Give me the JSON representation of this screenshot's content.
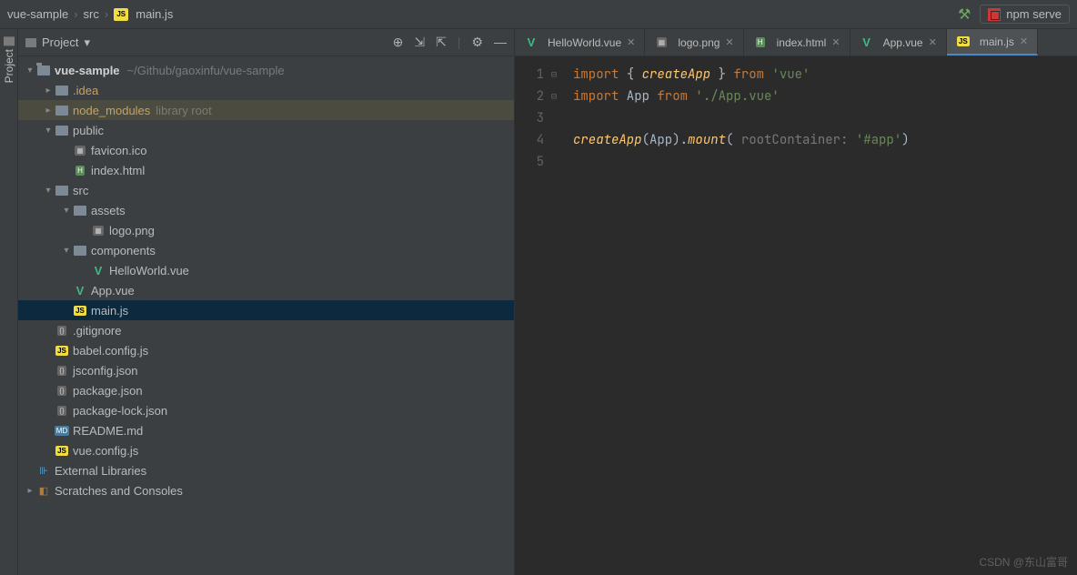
{
  "breadcrumb": {
    "items": [
      "vue-sample",
      "src",
      "main.js"
    ],
    "file_icon": "js"
  },
  "top_right": {
    "build_icon": "hammer",
    "run_config": {
      "icon": "npm",
      "label": "npm serve"
    }
  },
  "left_gutter": {
    "label": "Project"
  },
  "panel": {
    "title": "Project",
    "toolbar_icons": [
      "target",
      "expand",
      "collapse",
      "divider",
      "gear",
      "minimize"
    ]
  },
  "tree": [
    {
      "depth": 0,
      "chevron": "down",
      "icon": "folder-root",
      "label": "vue-sample",
      "bold": true,
      "hint": "~/Github/gaoxinfu/vue-sample"
    },
    {
      "depth": 1,
      "chevron": "right",
      "icon": "folder",
      "label": ".idea",
      "accent": true
    },
    {
      "depth": 1,
      "chevron": "right",
      "icon": "folder",
      "label": "node_modules",
      "accent": true,
      "suffix": "library root",
      "highlighted": true
    },
    {
      "depth": 1,
      "chevron": "down",
      "icon": "folder",
      "label": "public"
    },
    {
      "depth": 2,
      "chevron": "",
      "icon": "img",
      "label": "favicon.ico"
    },
    {
      "depth": 2,
      "chevron": "",
      "icon": "html",
      "label": "index.html"
    },
    {
      "depth": 1,
      "chevron": "down",
      "icon": "folder",
      "label": "src"
    },
    {
      "depth": 2,
      "chevron": "down",
      "icon": "folder",
      "label": "assets"
    },
    {
      "depth": 3,
      "chevron": "",
      "icon": "img",
      "label": "logo.png"
    },
    {
      "depth": 2,
      "chevron": "down",
      "icon": "folder",
      "label": "components"
    },
    {
      "depth": 3,
      "chevron": "",
      "icon": "vue",
      "label": "HelloWorld.vue"
    },
    {
      "depth": 2,
      "chevron": "",
      "icon": "vue",
      "label": "App.vue"
    },
    {
      "depth": 2,
      "chevron": "",
      "icon": "js",
      "label": "main.js",
      "selected": true
    },
    {
      "depth": 1,
      "chevron": "",
      "icon": "json",
      "label": ".gitignore"
    },
    {
      "depth": 1,
      "chevron": "",
      "icon": "js",
      "label": "babel.config.js"
    },
    {
      "depth": 1,
      "chevron": "",
      "icon": "json",
      "label": "jsconfig.json"
    },
    {
      "depth": 1,
      "chevron": "",
      "icon": "json",
      "label": "package.json"
    },
    {
      "depth": 1,
      "chevron": "",
      "icon": "json",
      "label": "package-lock.json"
    },
    {
      "depth": 1,
      "chevron": "",
      "icon": "md",
      "label": "README.md"
    },
    {
      "depth": 1,
      "chevron": "",
      "icon": "js",
      "label": "vue.config.js"
    },
    {
      "depth": 0,
      "chevron": "",
      "icon": "lib",
      "label": "External Libraries"
    },
    {
      "depth": 0,
      "chevron": "right",
      "icon": "scratch",
      "label": "Scratches and Consoles"
    }
  ],
  "tabs": [
    {
      "icon": "vue",
      "label": "HelloWorld.vue",
      "active": false
    },
    {
      "icon": "img",
      "label": "logo.png",
      "active": false
    },
    {
      "icon": "html",
      "label": "index.html",
      "active": false
    },
    {
      "icon": "vue",
      "label": "App.vue",
      "active": false
    },
    {
      "icon": "js",
      "label": "main.js",
      "active": true
    }
  ],
  "editor": {
    "line_numbers": [
      "1",
      "2",
      "3",
      "4",
      "5"
    ],
    "lines": [
      {
        "tokens": [
          {
            "t": "kw",
            "v": "import"
          },
          {
            "t": "ident",
            "v": " { "
          },
          {
            "t": "fn",
            "v": "createApp"
          },
          {
            "t": "ident",
            "v": " } "
          },
          {
            "t": "kw",
            "v": "from"
          },
          {
            "t": "ident",
            "v": " "
          },
          {
            "t": "str",
            "v": "'vue'"
          }
        ]
      },
      {
        "tokens": [
          {
            "t": "kw",
            "v": "import"
          },
          {
            "t": "ident",
            "v": " App "
          },
          {
            "t": "kw",
            "v": "from"
          },
          {
            "t": "ident",
            "v": " "
          },
          {
            "t": "str",
            "v": "'./App.vue'"
          }
        ]
      },
      {
        "tokens": []
      },
      {
        "tokens": [
          {
            "t": "fn",
            "v": "createApp"
          },
          {
            "t": "ident",
            "v": "(App)."
          },
          {
            "t": "fn",
            "v": "mount"
          },
          {
            "t": "ident",
            "v": "( "
          },
          {
            "t": "hint",
            "v": "rootContainer: "
          },
          {
            "t": "str",
            "v": "'#app'"
          },
          {
            "t": "ident",
            "v": ")"
          }
        ]
      },
      {
        "tokens": []
      }
    ]
  },
  "watermark": "CSDN @东山富哥"
}
